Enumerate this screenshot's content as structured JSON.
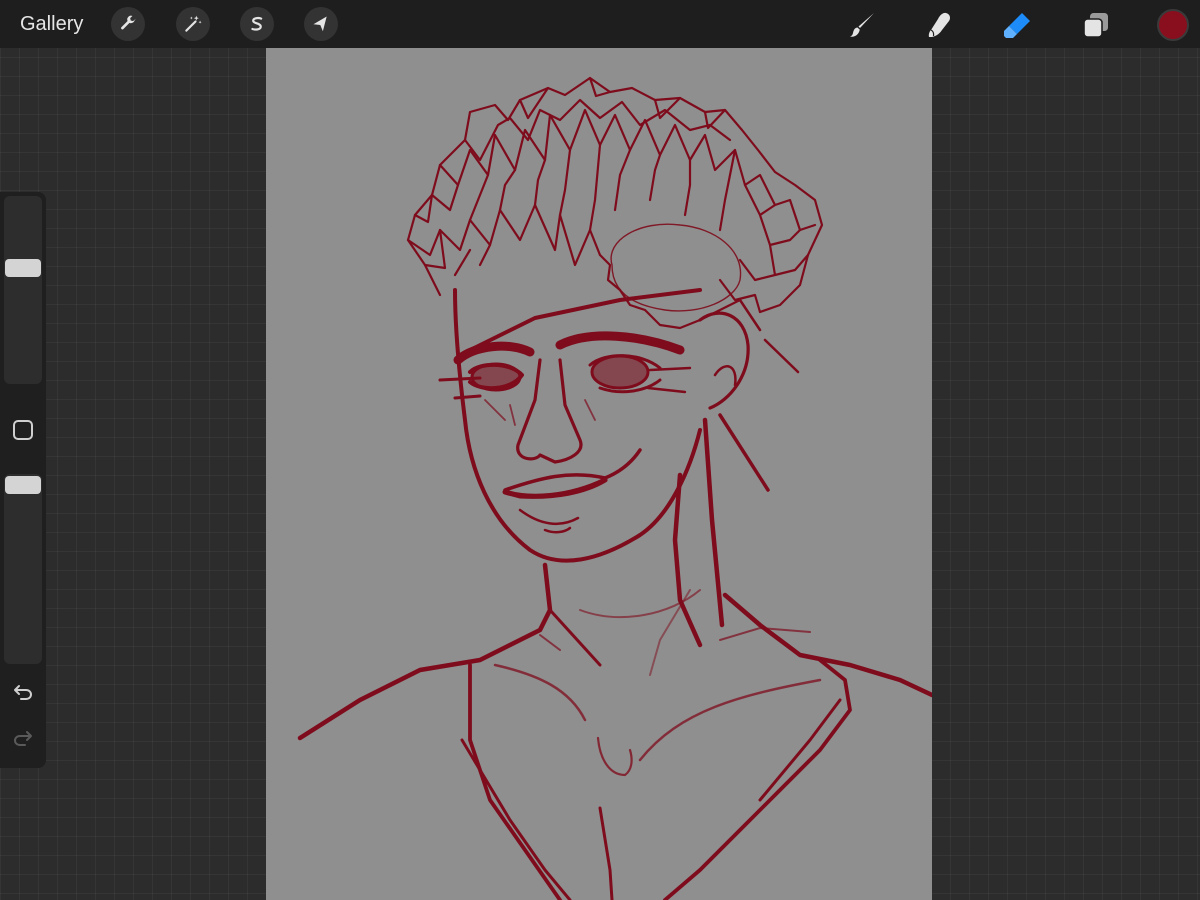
{
  "app": {
    "gallery_label": "Gallery"
  },
  "toolbar": {
    "left_tools": [
      {
        "name": "actions",
        "icon": "wrench-icon"
      },
      {
        "name": "adjustments",
        "icon": "magic-wand-icon"
      },
      {
        "name": "selection",
        "icon": "selection-s-icon"
      },
      {
        "name": "transform",
        "icon": "arrow-cursor-icon"
      }
    ],
    "right_tools": [
      {
        "name": "brush",
        "icon": "paintbrush-icon",
        "active": false
      },
      {
        "name": "smudge",
        "icon": "smudge-finger-icon",
        "active": false
      },
      {
        "name": "eraser",
        "icon": "eraser-icon",
        "active": true
      },
      {
        "name": "layers",
        "icon": "layers-icon",
        "active": false
      }
    ],
    "current_color": "#8a0f1e",
    "accent_color": "#1d8cf8"
  },
  "sidebar": {
    "brush_size_level": 0.63,
    "opacity_level": 1.0,
    "modify_icon": "square-modify-icon",
    "undo_icon": "undo-arrow-icon",
    "redo_icon": "redo-arrow-icon"
  },
  "canvas": {
    "background_color": "#8f8f8f",
    "stroke_color": "#7e0c1c"
  }
}
